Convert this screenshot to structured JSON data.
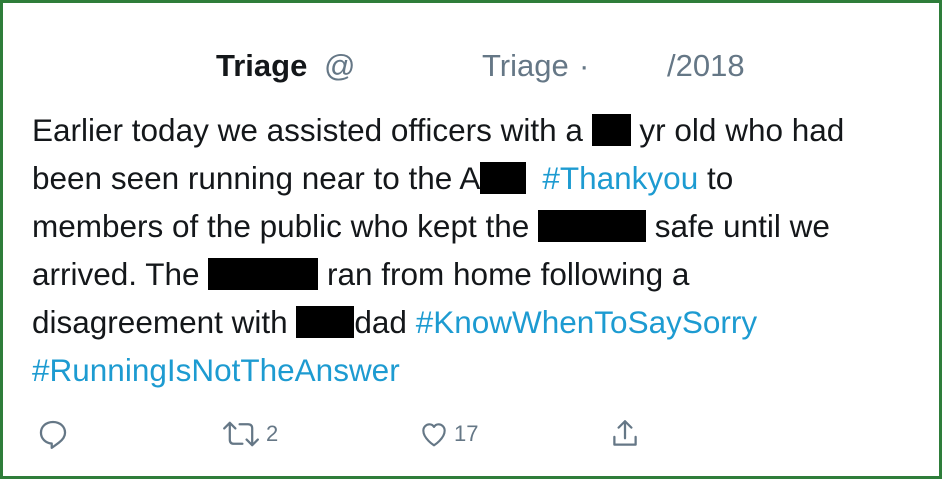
{
  "tweet": {
    "name": "Triage",
    "at_prefix": "@",
    "handle_text": "Triage",
    "separator": "·",
    "date_suffix": "/2018",
    "lines": {
      "l1a": "Earlier today we assisted officers with a ",
      "l1b": " yr old who had",
      "l2a": "been seen running near to the A",
      "l2tag": "#Thankyou",
      "l2b": " to",
      "l3a": "members of the public who kept the ",
      "l3b": " safe until we",
      "l4a": "arrived.  The ",
      "l4b": " ran from home following a",
      "l5a": "disagreement with ",
      "l5b": "dad ",
      "l5tag": "#KnowWhenToSaySorry",
      "l6tag": "#RunningIsNotTheAnswer"
    }
  },
  "actions": {
    "reply_icon": "reply-icon",
    "retweet_count": "2",
    "like_count": "17",
    "share_icon": "share-icon"
  },
  "colors": {
    "frame": "#2e7d3a",
    "hashtag": "#1d9bd1",
    "meta": "#657786",
    "text": "#14171a"
  }
}
